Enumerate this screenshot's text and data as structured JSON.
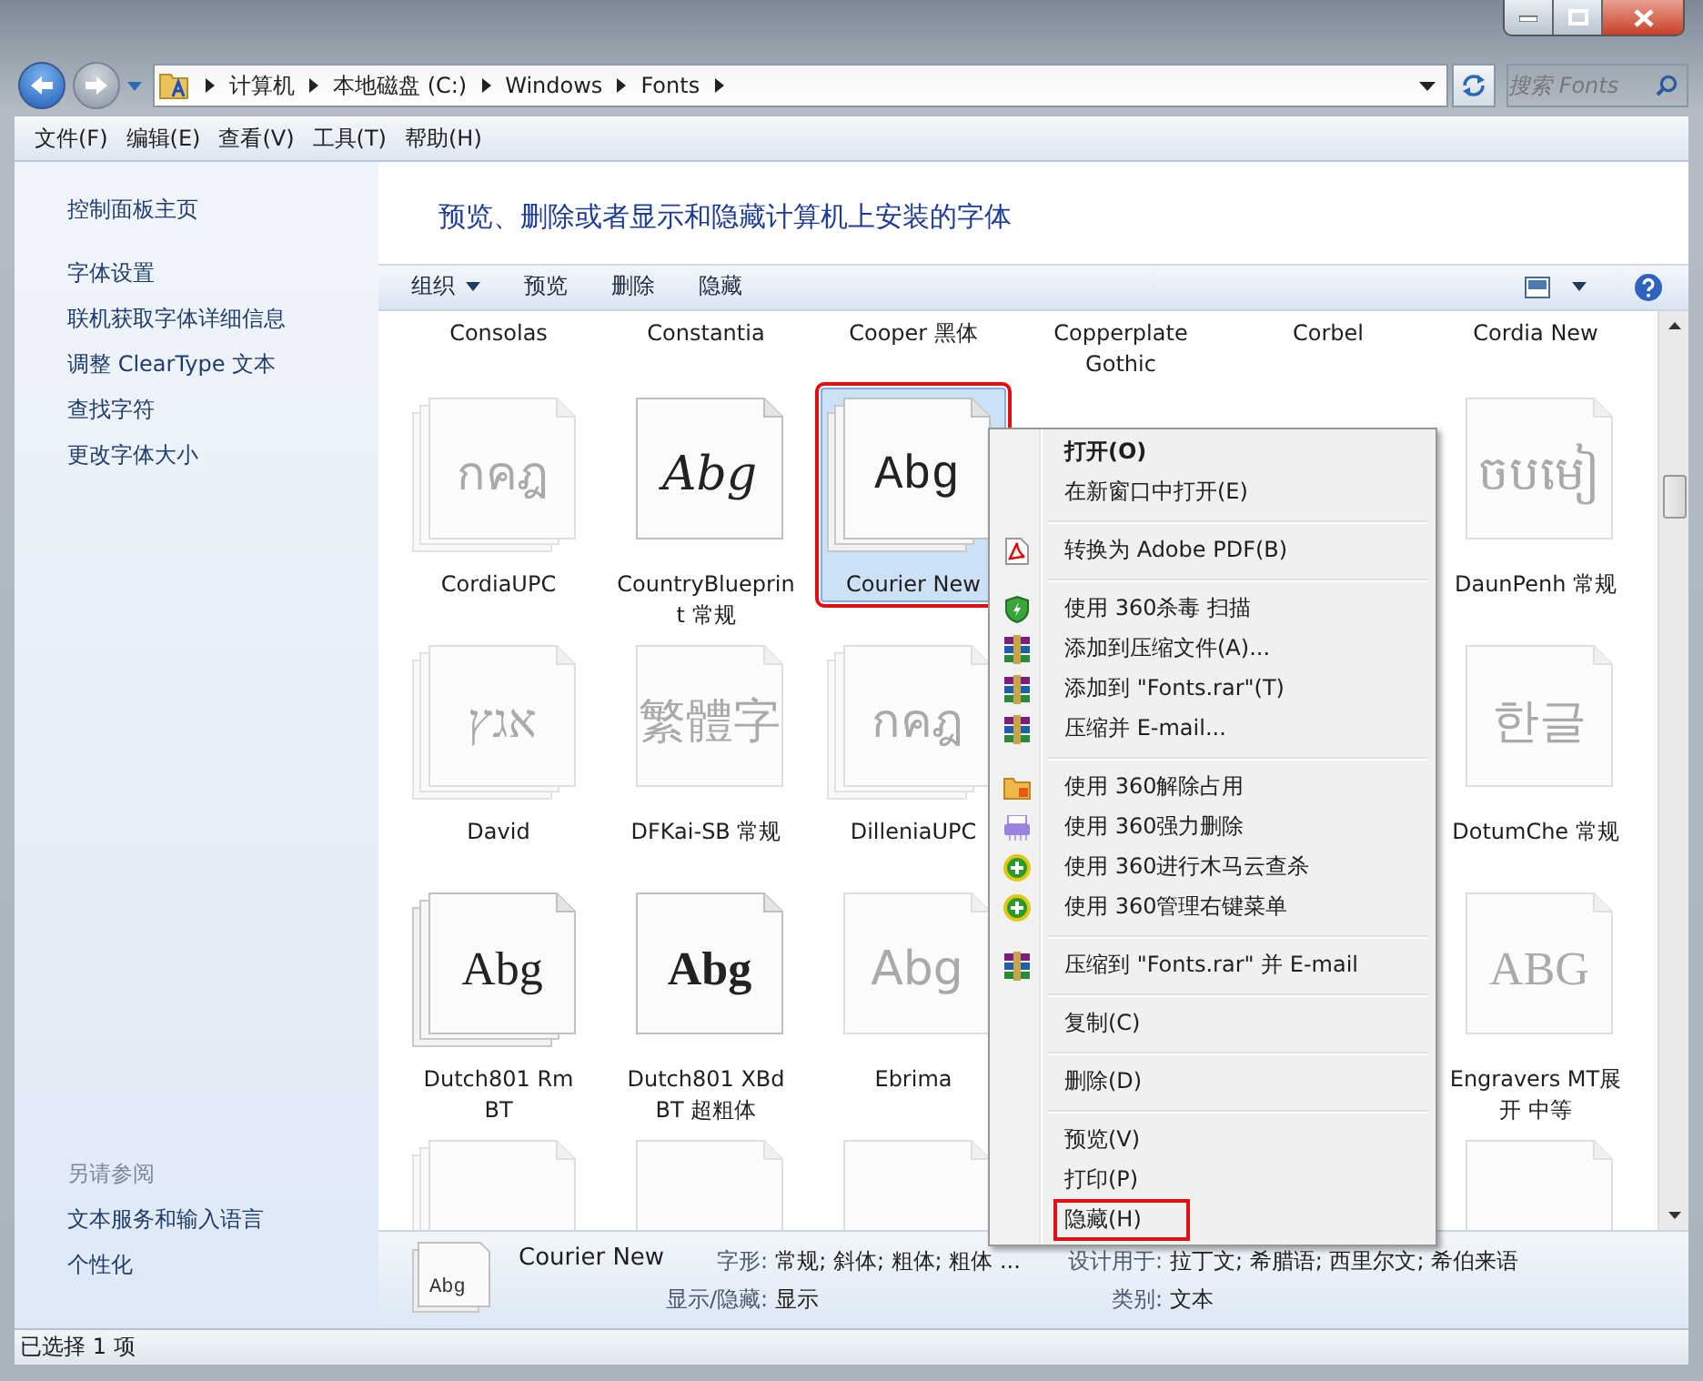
{
  "address_bar": {
    "crumbs": [
      "计算机",
      "本地磁盘 (C:)",
      "Windows",
      "Fonts"
    ],
    "search": {
      "placeholder": "搜索 Fonts"
    }
  },
  "menu_bar": [
    "文件(F)",
    "编辑(E)",
    "查看(V)",
    "工具(T)",
    "帮助(H)"
  ],
  "sidebar": {
    "home": "控制面板主页",
    "links": [
      "字体设置",
      "联机获取字体详细信息",
      "调整 ClearType 文本",
      "查找字符",
      "更改字体大小"
    ],
    "see_also_title": "另请参阅",
    "see_also": [
      "文本服务和输入语言",
      "个性化"
    ]
  },
  "header": "预览、删除或者显示和隐藏计算机上安装的字体",
  "toolbar": {
    "organize": "组织",
    "buttons": [
      "预览",
      "删除",
      "隐藏"
    ]
  },
  "grid_rows": [
    {
      "items": [
        {
          "kind": "label",
          "label": "Consolas"
        },
        {
          "kind": "label",
          "label": "Constantia"
        },
        {
          "kind": "label",
          "label": "Cooper 黑体"
        },
        {
          "kind": "label",
          "label": "Copperplate Gothic"
        },
        {
          "kind": "label",
          "label": "Corbel"
        },
        {
          "kind": "label",
          "label": "Cordia New"
        }
      ]
    },
    {
      "items": [
        {
          "kind": "sans",
          "label": "CordiaUPC",
          "sample": "กคฎ",
          "family": true,
          "hidden": true,
          "selected": false
        },
        {
          "kind": "script",
          "label": "CountryBlueprint 常规",
          "sample": "Abg",
          "family": false,
          "hidden": false,
          "selected": false
        },
        {
          "kind": "mono",
          "label": "Courier New",
          "sample": "Abg",
          "family": true,
          "hidden": false,
          "selected": true,
          "annotated": true
        },
        {
          "kind": "covered"
        },
        {
          "kind": "covered"
        },
        {
          "kind": "sans",
          "label": "DaunPenh 常规",
          "sample": "ចបមៀ",
          "family": false,
          "hidden": true,
          "selected": false
        }
      ]
    },
    {
      "items": [
        {
          "kind": "serif",
          "label": "David",
          "sample": "אגץ",
          "family": true,
          "hidden": true,
          "selected": false
        },
        {
          "kind": "serif",
          "label": "DFKai-SB 常规",
          "sample": "繁體字",
          "family": false,
          "hidden": true,
          "selected": false
        },
        {
          "kind": "sans",
          "label": "DilleniaUPC",
          "sample": "กคฎ",
          "family": true,
          "hidden": true,
          "selected": false
        },
        {
          "kind": "covered"
        },
        {
          "kind": "covered"
        },
        {
          "kind": "sans",
          "label": "DotumChe 常规",
          "sample": "한글",
          "family": false,
          "hidden": true,
          "selected": false
        }
      ]
    },
    {
      "items": [
        {
          "kind": "serif",
          "label": "Dutch801 Rm BT",
          "sample": "Abg",
          "family": true,
          "hidden": false,
          "selected": false
        },
        {
          "kind": "bold",
          "label": "Dutch801 XBd BT 超粗体",
          "sample": "Abg",
          "family": false,
          "hidden": false,
          "selected": false
        },
        {
          "kind": "sans",
          "label": "Ebrima",
          "sample": "Abg",
          "family": false,
          "hidden": true,
          "selected": false
        },
        {
          "kind": "covered"
        },
        {
          "kind": "covered"
        },
        {
          "kind": "serif",
          "label": "Engravers MT展开 中等",
          "sample": "ABG",
          "family": false,
          "hidden": true,
          "selected": false
        }
      ]
    },
    {
      "items": [
        {
          "kind": "sans",
          "family": true,
          "hidden": true,
          "selected": false
        },
        {
          "kind": "sans",
          "family": false,
          "hidden": true,
          "selected": false
        },
        {
          "kind": "sans",
          "family": false,
          "hidden": true,
          "selected": false
        },
        {
          "kind": "covered"
        },
        {
          "kind": "covered"
        },
        {
          "kind": "sans",
          "family": false,
          "hidden": true,
          "selected": false
        }
      ]
    }
  ],
  "context_menu": [
    {
      "kind": "plain",
      "label": "打开(O)",
      "default": true
    },
    {
      "kind": "plain",
      "label": "在新窗口中打开(E)",
      "default": false
    },
    {
      "kind": "separator"
    },
    {
      "kind": "pdf",
      "label": "转换为 Adobe PDF(B)",
      "default": false
    },
    {
      "kind": "separator"
    },
    {
      "kind": "shield",
      "label": "使用 360杀毒 扫描",
      "default": false
    },
    {
      "kind": "archive",
      "label": "添加到压缩文件(A)...",
      "default": false
    },
    {
      "kind": "archive",
      "label": "添加到 \"Fonts.rar\"(T)",
      "default": false
    },
    {
      "kind": "archive",
      "label": "压缩并 E-mail...",
      "default": false
    },
    {
      "kind": "separator"
    },
    {
      "kind": "folder",
      "label": "使用 360解除占用",
      "default": false
    },
    {
      "kind": "shredder",
      "label": "使用 360强力删除",
      "default": false
    },
    {
      "kind": "plus",
      "label": "使用 360进行木马云查杀",
      "default": false
    },
    {
      "kind": "plus",
      "label": "使用 360管理右键菜单",
      "default": false
    },
    {
      "kind": "separator"
    },
    {
      "kind": "archive",
      "label": "压缩到 \"Fonts.rar\" 并 E-mail",
      "default": false
    },
    {
      "kind": "separator"
    },
    {
      "kind": "plain",
      "label": "复制(C)",
      "default": false
    },
    {
      "kind": "separator"
    },
    {
      "kind": "plain",
      "label": "删除(D)",
      "default": false
    },
    {
      "kind": "separator"
    },
    {
      "kind": "plain",
      "label": "预览(V)",
      "default": false
    },
    {
      "kind": "plain",
      "label": "打印(P)",
      "default": false
    },
    {
      "kind": "plain",
      "label": "隐藏(H)",
      "default": false,
      "annotated": true
    }
  ],
  "details": {
    "sample": "Abg",
    "name": "Courier New",
    "properties": [
      {
        "label": "字形:",
        "value": "常规; 斜体; 粗体; 粗体 ..."
      },
      {
        "label": "设计用于:",
        "value": "拉丁文; 希腊语; 西里尔文; 希伯来语"
      },
      {
        "label": "显示/隐藏:",
        "value": "显示"
      },
      {
        "label": "类别:",
        "value": "文本"
      }
    ]
  },
  "status_bar": "已选择 1 项"
}
